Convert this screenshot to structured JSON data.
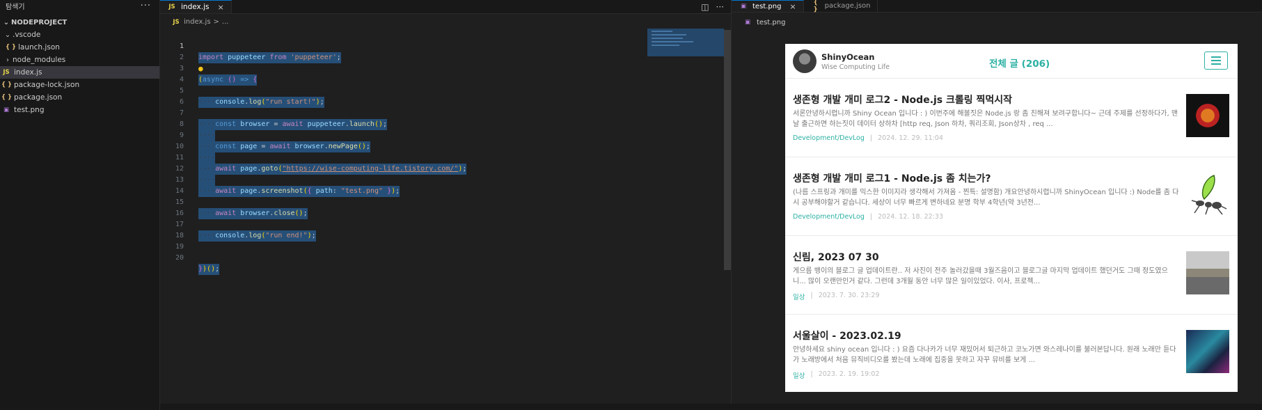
{
  "explorer": {
    "title": "탐색기",
    "more": "···",
    "project": "NODEPROJECT",
    "items": [
      {
        "label": ".vscode",
        "chevron": "⌄",
        "icon": ""
      },
      {
        "label": "launch.json",
        "chevron": "",
        "icon": "{ }"
      },
      {
        "label": "node_modules",
        "chevron": "›",
        "icon": ""
      },
      {
        "label": "index.js",
        "chevron": "",
        "icon": "JS"
      },
      {
        "label": "package-lock.json",
        "chevron": "",
        "icon": "{ }"
      },
      {
        "label": "package.json",
        "chevron": "",
        "icon": "{ }"
      },
      {
        "label": "test.png",
        "chevron": "",
        "icon": "▣"
      }
    ]
  },
  "editor": {
    "tab_icon": "JS",
    "tab_label": "index.js",
    "tab_close": "×",
    "split_icon": "◫",
    "more": "···",
    "breadcrumb_file": "index.js",
    "breadcrumb_sep": ">",
    "breadcrumb_rest": "...",
    "lines": [
      "1",
      "2",
      "3",
      "4",
      "5",
      "6",
      "7",
      "8",
      "9",
      "10",
      "11",
      "12",
      "13",
      "14",
      "15",
      "16",
      "17",
      "18",
      "19",
      "20"
    ],
    "code": {
      "import_kw": "import",
      "import_name": "puppeteer",
      "from_kw": "from",
      "import_src": "'puppeteer'",
      "semi": ";",
      "async_kw": "async",
      "arrow": "=>",
      "console": "console",
      "log": "log",
      "start_msg": "\"run start!\"",
      "end_msg": "\"run end!\"",
      "const_kw": "const",
      "await_kw": "await",
      "browser": "browser",
      "page": "page",
      "launch": "launch",
      "newPage": "newPage",
      "goto": "goto",
      "url": "\"https://wise-computing-life.tistory.com/\"",
      "screenshot": "screenshot",
      "path_key": "path",
      "png": "\"test.png\"",
      "close": "close"
    }
  },
  "preview_panel": {
    "tab1_icon": "▣",
    "tab1_label": "test.png",
    "tab1_close": "×",
    "tab2_icon": "{ }",
    "tab2_label": "package.json",
    "breadcrumb_icon": "▣",
    "breadcrumb_file": "test.png"
  },
  "blog": {
    "name": "ShinyOcean",
    "subtitle": "Wise Computing Life",
    "count_label": "전체 글 (206)",
    "posts": [
      {
        "title": "생존형 개발 개미 로그2 - Node.js 크롤링 찍먹시작",
        "excerpt": "서론안녕하시렵니까 Shiny Ocean 입니다 : ) 이번주에 해볼짓은 Node.js 랑 좀 친해져 보려구합니다~ 근데 주제를 선정하다가, 맨날 출근하면 하는짓이 데이터 상하차 [http req, Json 하차, 쿼리조회, Json상차 , req ...",
        "category": "Development/DevLog",
        "date": "2024. 12. 29. 11:04"
      },
      {
        "title": "생존형 개발 개미 로그1 - Node.js 좀 치는가?",
        "excerpt": "(나름 스프링과 개미를 믹스한 이미지라 생각해서 가져옴 - 찐특: 설명함) 개요안녕하시렵니까 ShinyOcean 입니다 :) Node를 좀 다시 공부해야할거 같습니다. 세상이 너무 빠르게 변하네요 분명 학부 4학년(약 3년전...",
        "category": "Development/DevLog",
        "date": "2024. 12. 18. 22:33"
      },
      {
        "title": "신림, 2023 07 30",
        "excerpt": "게으름 뱅이의 블로그 글 업데이트란.. 저 사진이 전주 놀러갔을때 3월즈음이고 블로그글 마지막 업데이트 했던거도 그때 정도였으니... 많이 오랜만인거 같다. 그런데 3개월 동안 너무 많은 일이있었다. 이사, 프로젝...",
        "category": "일상",
        "date": "2023. 7. 30. 23:29"
      },
      {
        "title": "서울살이 - 2023.02.19",
        "excerpt": "안녕하세요 shiny ocean 입니다 : ) 요즘 다나카가 너무 재밌어서 퇴근하고 코노가면 와스레나이를 불러본답니다. 원래 노래만 듣다가 노래방에서 처음 뮤직비디오를 봤는데 노래에 집중을 못하고 자꾸 뮤비를 보게 ...",
        "category": "일상",
        "date": "2023. 2. 19. 19:02"
      }
    ]
  }
}
